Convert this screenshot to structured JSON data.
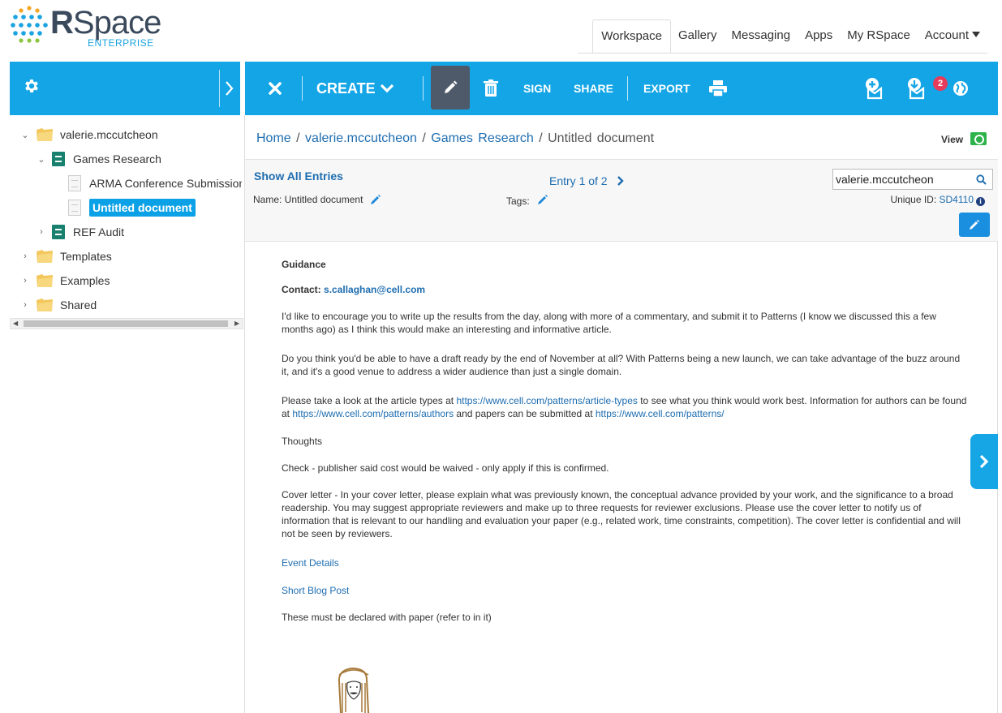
{
  "app": {
    "logo_main": "Space",
    "logo_r": "R",
    "logo_sub": "ENTERPRISE"
  },
  "topnav": {
    "items": [
      "Workspace",
      "Gallery",
      "Messaging",
      "Apps",
      "My RSpace",
      "Account"
    ],
    "active": "Workspace"
  },
  "toolbar": {
    "create_label": "CREATE",
    "sign_label": "SIGN",
    "share_label": "SHARE",
    "export_label": "EXPORT",
    "notification_count": "2"
  },
  "tree": {
    "root": "valerie.mccutcheon",
    "notebook_1": "Games Research",
    "doc_1": "ARMA Conference Submission",
    "doc_2": "Untitled document",
    "notebook_2": "REF Audit",
    "folder_templates": "Templates",
    "folder_examples": "Examples",
    "folder_shared": "Shared"
  },
  "breadcrumb": {
    "home": "Home",
    "sep": "/",
    "user": "valerie.mccutcheon",
    "notebook": "Games Research",
    "current": "Untitled document",
    "view_label": "View"
  },
  "info": {
    "show_all": "Show All Entries",
    "name_label": "Name: Untitled document",
    "tags_label": "Tags:",
    "entry_label": "Entry 1 of 2",
    "search_value": "valerie.mccutcheon",
    "uid_label": "Unique ID:",
    "uid_value": "SD4110"
  },
  "document": {
    "p1": "Guidance",
    "p2_label": "Contact:",
    "p2_email": "s.callaghan@cell.com",
    "p3": "I'd like to encourage you to write up the results from the day, along with more of a commentary, and submit it to Patterns (I know we discussed this a few months ago) as I think this would make an interesting and informative article.",
    "p4": "Do you think you'd be able to have a draft ready by the end of November at all? With Patterns being a new launch, we can take advantage of the buzz around it, and it's a good venue to address a wider audience than just a single domain.",
    "p5_a": "Please take a look at the article types at ",
    "p5_link1": "https://www.cell.com/patterns/article-types",
    "p5_b": " to see what you think would work best. Information for authors can be found at ",
    "p5_link2": "https://www.cell.com/patterns/authors",
    "p5_c": " and papers can be submitted at ",
    "p5_link3": "https://www.cell.com/patterns/",
    "p6": "Thoughts",
    "p7": "Check - publisher said cost would be waived - only apply if this is confirmed.",
    "p8": "Cover letter - In your cover letter, please explain what was previously known, the conceptual advance provided by your work, and the significance to a broad readership. You may suggest appropriate reviewers and make up to three requests for reviewer exclusions. Please use the cover letter to notify us of information that is relevant to our handling and evaluation your paper (e.g., related work, time constraints, competition). The cover letter is confidential and will not be seen by reviewers.",
    "p9": "Event Details",
    "p10": "Short Blog Post",
    "p11": "These must be declared with paper (refer to in it)"
  },
  "colors": {
    "accent_blue": "#13a5e6",
    "link_blue": "#1e6db0",
    "edit_active": "#4e5a6a",
    "badge_red": "#e63b5b",
    "notebook_green": "#17806e",
    "folder_yellow": "#f3c75c"
  },
  "icons": {
    "gear": "gear-icon",
    "close": "close-icon",
    "pencil": "pencil-icon",
    "trash": "trash-icon",
    "print": "print-icon",
    "globe": "globe-icon"
  }
}
